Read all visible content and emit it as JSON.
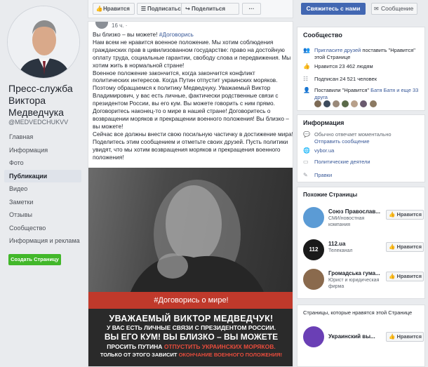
{
  "page": {
    "name": "Пресс-служба Виктора Медведчука",
    "handle": "@MEDVEDCHUKVV"
  },
  "nav": [
    "Главная",
    "Информация",
    "Фото",
    "Публикации",
    "Видео",
    "Заметки",
    "Отзывы",
    "Сообщество",
    "Информация и реклама"
  ],
  "create_page_label": "Создать Страницу",
  "topbar": {
    "like": "Нравится",
    "follow": "Подписаться",
    "share": "Поделиться",
    "more": "···",
    "cta": "Свяжитесь с нами",
    "message": "Сообщение"
  },
  "post": {
    "time": "16 ч. ·",
    "paragraphs": [
      "Вы близко – вы можете!",
      "Нам всем не нравится военное положение. Мы хотим соблюдения гражданских прав в цивилизованном государстве: право на достойную оплату труда, социальные гарантии, свободу слова и передвижения. Мы хотим жить в нормальной стране!",
      "Военное положение закончится, когда закончится конфликт политических интересов. Когда Путин отпустит украинских моряков. Поэтому обращаемся к политику Медведчуку. Уважаемый Виктор Владимирович, у вас есть личные, фактически родственные связи с президентом России, вы его кум. Вы можете говорить с ним прямо. Договоритесь наконец-то о мире в нашей стране! Договоритесь о возвращении моряков и прекращении военного положения! Вы близко – вы можете!",
      "Сейчас все должны внести свою посильную частичку в достижение мира! Поделитесь этим сообщением и отметьте своих друзей. Пусть политики увидят, что мы хотим возвращения моряков и прекращения военного положения!"
    ],
    "hashtag": "#Договорись",
    "image": {
      "banner_red": "#Договорись о мире!",
      "line1": "УВАЖАЕМЫЙ ВИКТОР МЕДВЕДЧУК!",
      "line2": "У ВАС ЕСТЬ ЛИЧНЫЕ СВЯЗИ С ПРЕЗИДЕНТОМ РОССИИ.",
      "line3": "ВЫ ЕГО КУМ! ВЫ БЛИЗКО – ВЫ МОЖЕТЕ",
      "line4_a": "ПРОСИТЬ ПУТИНА ",
      "line4_b": "ОТПУСТИТЬ УКРАИНСКИХ МОРЯКОВ.",
      "line5_a": "ТОЛЬКО ОТ ЭТОГО ЗАВИСИТ ",
      "line5_b": "ОКОНЧАНИЕ ВОЕННОГО ПОЛОЖЕНИЯ!"
    }
  },
  "community": {
    "title": "Сообщество",
    "invite_link": "Пригласите друзей",
    "invite_rest": " поставить \"Нравится\" этой Странице",
    "likes": "Нравится 23 462 людям",
    "follows": "Подписан 24 521 человек",
    "friends_prefix": "Поставили \"Нравится\" ",
    "friends_names": "Батя Батя и еще 33 друга"
  },
  "info": {
    "title": "Информация",
    "response": "Обычно отвечает моментально",
    "send_message": "Отправить сообщение",
    "website": "vybor.ua",
    "category": "Политические деятели",
    "rules": "Правки"
  },
  "similar": {
    "title": "Похожие Страницы",
    "items": [
      {
        "name": "Союз Православ...",
        "category": "СМИ/новостная компания",
        "like": "Нравится"
      },
      {
        "name": "112.ua",
        "category": "Телеканал",
        "like": "Нравится"
      },
      {
        "name": "Громадська гума...",
        "category": "Юрист и юридическая фирма",
        "like": "Нравится"
      }
    ]
  },
  "liked_by_page": {
    "title": "Страницы, которые нравятся этой Странице",
    "items": [
      {
        "name": "Украинский вы...",
        "like": "Нравится"
      }
    ]
  },
  "colors": {
    "brand": "#4267b2",
    "link": "#385898",
    "create_button": "#42b72a",
    "banner_red": "#c0392b"
  }
}
